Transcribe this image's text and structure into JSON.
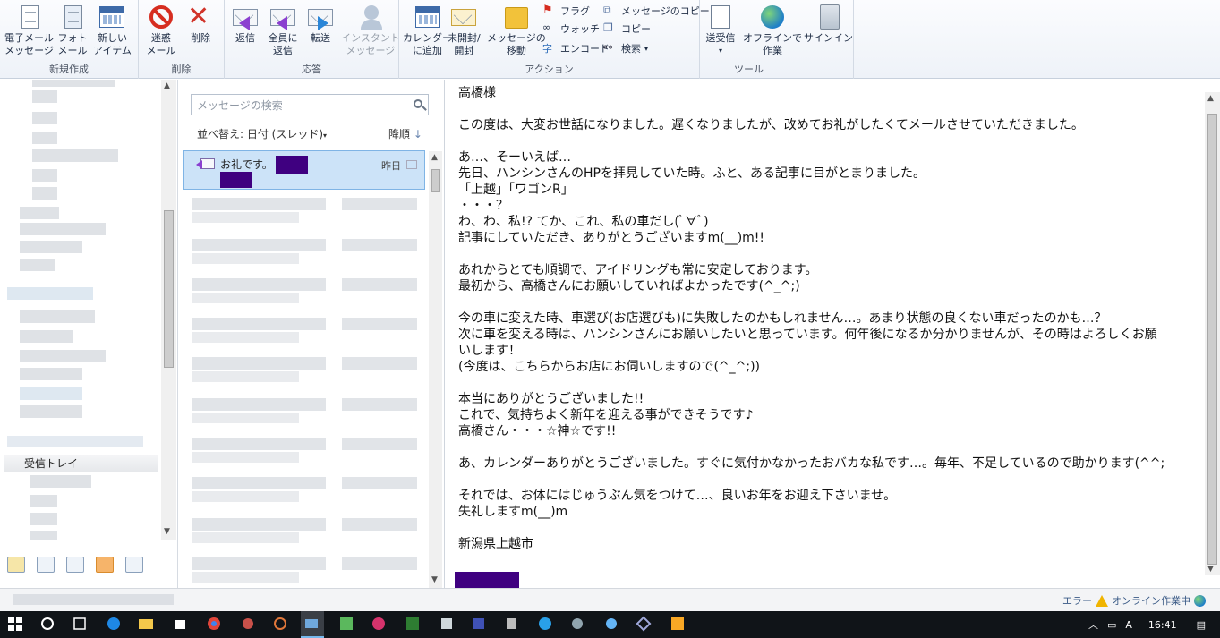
{
  "ribbon": {
    "groups": {
      "new": "新規作成",
      "delete": "削除",
      "respond": "応答",
      "actions": "アクション",
      "tools": "ツール"
    },
    "buttons": {
      "new_mail": [
        "電子メール",
        "メッセージ"
      ],
      "photo_mail": [
        "フォト",
        "メール"
      ],
      "new_item": [
        "新しい",
        "アイテム"
      ],
      "junk": [
        "迷惑",
        "メール"
      ],
      "delete": [
        "削除"
      ],
      "reply": [
        "返信"
      ],
      "reply_all": [
        "全員に",
        "返信"
      ],
      "forward": [
        "転送"
      ],
      "instant_message": [
        "インスタント",
        "メッセージ"
      ],
      "add_calendar": [
        "カレンダー",
        "に追加"
      ],
      "unread": [
        "未開封/",
        "開封"
      ],
      "move_message": [
        "メッセージの",
        "移動"
      ],
      "send_receive": [
        "送受信"
      ],
      "work_offline": [
        "オフラインで",
        "作業"
      ],
      "sign_in": [
        "サインイン"
      ]
    },
    "small": {
      "flag": "フラグ",
      "watch": "ウォッチ",
      "encode": "エンコード",
      "copy_message": "メッセージのコピー",
      "copy": "コピー",
      "search": "検索"
    }
  },
  "nav": {
    "inbox": "受信トレイ"
  },
  "list": {
    "search_placeholder": "メッセージの検索",
    "sort_label": "並べ替え: 日付 (スレッド)",
    "order_label": "降順",
    "selected": {
      "subject": "お礼です。",
      "date": "昨日"
    }
  },
  "reading": {
    "body": "高橋様\n\nこの度は、大変お世話になりました。遅くなりましたが、改めてお礼がしたくてメールさせていただきました。\n\nあ…、そーいえば…\n先日、ハンシンさんのHPを拝見していた時。ふと、ある記事に目がとまりました。\n「上越」「ワゴンR」\n・・・？\nわ、わ、私!? てか、これ、私の車だし(ﾟ∀ﾟ)\n記事にしていただき、ありがとうございますm(__)m!!\n\nあれからとても順調で、アイドリングも常に安定しております。\n最初から、高橋さんにお願いしていればよかったです(^_^;)\n\n今の車に変えた時、車選び(お店選びも)に失敗したのかもしれません…。あまり状態の良くない車だったのかも…？\n次に車を変える時は、ハンシンさんにお願いしたいと思っています。何年後になるか分かりませんが、その時はよろしくお願\nいします！\n(今度は、こちらからお店にお伺いしますので(^_^;))\n\n本当にありがとうございました!!\nこれで、気持ちよく新年を迎える事ができそうです♪\n高橋さん・・・☆神☆です!!\n\nあ、カレンダーありがとうございました。すぐに気付かなかったおバカな私です…。毎年、不足しているので助かります(^^;\n\nそれでは、お体にはじゅうぶん気をつけて…、良いお年をお迎え下さいませ。\n失礼しますm(__)m\n\n新潟県上越市"
  },
  "status": {
    "right": "エラー",
    "right2": "オンライン作業中"
  },
  "taskbar": {
    "time": "16:41",
    "ime": "A"
  }
}
